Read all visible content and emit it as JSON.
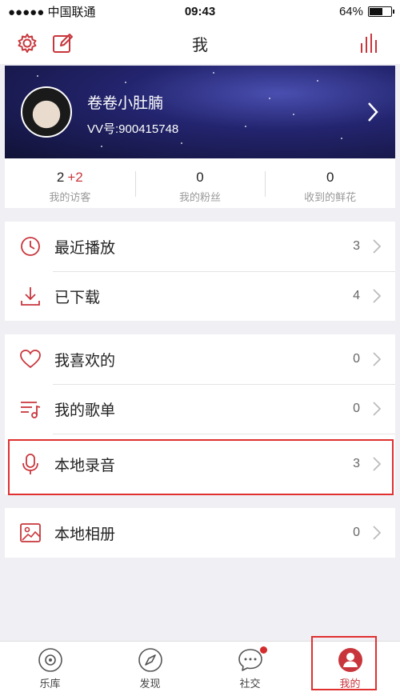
{
  "status_bar": {
    "carrier": "●●●●● 中国联通",
    "time": "09:43",
    "battery_text": "64%",
    "battery_level": 0.64
  },
  "nav": {
    "title": "我",
    "settings_icon": "gear-icon",
    "edit_icon": "edit-icon",
    "stats_icon": "bar-chart-icon"
  },
  "profile": {
    "username": "卷卷小肚腩",
    "vv_id": "VV号:900415748",
    "arrow_icon": "chevron-right-icon"
  },
  "stats": [
    {
      "value": "2",
      "delta": "+2",
      "label": "我的访客"
    },
    {
      "value": "0",
      "delta": "",
      "label": "我的粉丝"
    },
    {
      "value": "0",
      "delta": "",
      "label": "收到的鲜花"
    }
  ],
  "group1": [
    {
      "label": "最近播放",
      "count": "3",
      "icon": "clock-icon"
    },
    {
      "label": "已下载",
      "count": "4",
      "icon": "download-icon"
    }
  ],
  "group2": [
    {
      "label": "我喜欢的",
      "count": "0",
      "icon": "heart-icon"
    },
    {
      "label": "我的歌单",
      "count": "0",
      "icon": "playlist-icon"
    },
    {
      "label": "本地录音",
      "count": "3",
      "icon": "microphone-icon"
    }
  ],
  "group3": [
    {
      "label": "本地相册",
      "count": "0",
      "icon": "photo-album-icon"
    }
  ],
  "tabs": [
    {
      "label": "乐库",
      "icon": "disc-icon"
    },
    {
      "label": "发现",
      "icon": "compass-icon"
    },
    {
      "label": "社交",
      "icon": "chat-bubble-icon"
    },
    {
      "label": "我的",
      "icon": "user-icon"
    }
  ],
  "colors": {
    "accent": "#c8363c",
    "highlight_box": "#e03030",
    "background": "#f0eff4"
  }
}
